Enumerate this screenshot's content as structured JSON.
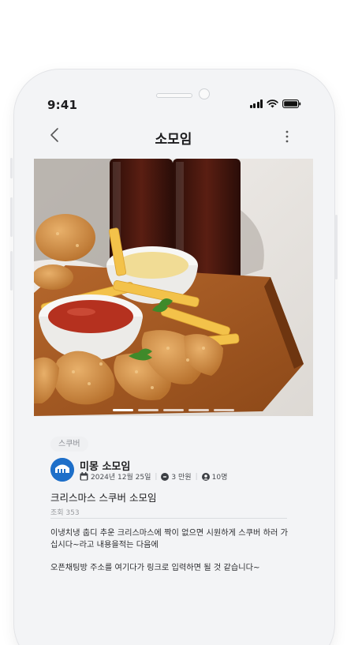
{
  "status_bar": {
    "time": "9:41"
  },
  "header": {
    "title": "소모임"
  },
  "hero": {
    "image": "fried-chicken-fries-ketchup-cola-photo",
    "pages": 5,
    "current_page": 1
  },
  "post": {
    "tag": "스쿠버",
    "host": "미몽 소모임",
    "date": "2024년 12월 25일",
    "price": "3 만원",
    "capacity": "10명",
    "title": "크리스마스 스쿠버 소모임",
    "views": "조회 353",
    "body_line1": "이냉치냉 춥디 추운 크리스마스에 짝이 없으면 시원하게 스쿠버 하러 가십시다~라고 내용을적는 다음에",
    "body_line2": "오픈채팅방 주소를 여기다가 링크로 입력하면 될 것 같습니다~"
  },
  "colors": {
    "accent": "#1e6fc9",
    "tag_bg": "#eff0f2",
    "text": "#1c1c1e"
  }
}
